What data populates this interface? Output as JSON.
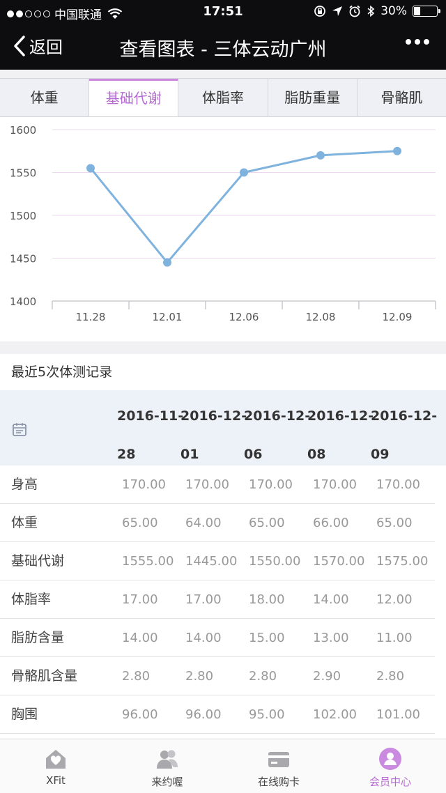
{
  "status": {
    "carrier": "中国联通",
    "time": "17:51",
    "battery": "30%",
    "battery_level": 0.3
  },
  "nav": {
    "back_label": "返回",
    "title": "查看图表 - 三体云动广州"
  },
  "tabs": [
    {
      "label": "体重",
      "active": false
    },
    {
      "label": "基础代谢",
      "active": true
    },
    {
      "label": "体脂率",
      "active": false
    },
    {
      "label": "脂肪重量",
      "active": false
    },
    {
      "label": "骨骼肌",
      "active": false
    }
  ],
  "chart_data": {
    "type": "line",
    "categories": [
      "11.28",
      "12.01",
      "12.06",
      "12.08",
      "12.09"
    ],
    "values": [
      1555,
      1445,
      1550,
      1570,
      1575
    ],
    "ylim": [
      1400,
      1600
    ],
    "yticks": [
      "1400",
      "1450",
      "1500",
      "1550",
      "1600"
    ],
    "color": "#7fb3de",
    "grid": true
  },
  "records": {
    "title": "最近5次体测记录",
    "dates": [
      {
        "l1": "2016-11-",
        "l2": "28"
      },
      {
        "l1": "2016-12-",
        "l2": "01"
      },
      {
        "l1": "2016-12-",
        "l2": "06"
      },
      {
        "l1": "2016-12-",
        "l2": "08"
      },
      {
        "l1": "2016-12-",
        "l2": "09"
      }
    ],
    "rows": [
      {
        "label": "身高",
        "values": [
          "170.00",
          "170.00",
          "170.00",
          "170.00",
          "170.00"
        ]
      },
      {
        "label": "体重",
        "values": [
          "65.00",
          "64.00",
          "65.00",
          "66.00",
          "65.00"
        ]
      },
      {
        "label": "基础代谢",
        "values": [
          "1555.00",
          "1445.00",
          "1550.00",
          "1570.00",
          "1575.00"
        ]
      },
      {
        "label": "体脂率",
        "values": [
          "17.00",
          "17.00",
          "18.00",
          "14.00",
          "12.00"
        ]
      },
      {
        "label": "脂肪含量",
        "values": [
          "14.00",
          "14.00",
          "15.00",
          "13.00",
          "11.00"
        ]
      },
      {
        "label": "骨骼肌含量",
        "values": [
          "2.80",
          "2.80",
          "2.80",
          "2.90",
          "2.80"
        ]
      },
      {
        "label": "胸围",
        "values": [
          "96.00",
          "96.00",
          "95.00",
          "102.00",
          "101.00"
        ]
      }
    ]
  },
  "tabbar": [
    {
      "label": "XFit",
      "icon": "home-icon",
      "active": false
    },
    {
      "label": "来约喔",
      "icon": "people-icon",
      "active": false
    },
    {
      "label": "在线购卡",
      "icon": "card-icon",
      "active": false
    },
    {
      "label": "会员中心",
      "icon": "member-icon",
      "active": true
    }
  ],
  "colors": {
    "accent": "#b66bd3",
    "line": "#7fb3de",
    "header_bg": "#0d0d0f"
  }
}
